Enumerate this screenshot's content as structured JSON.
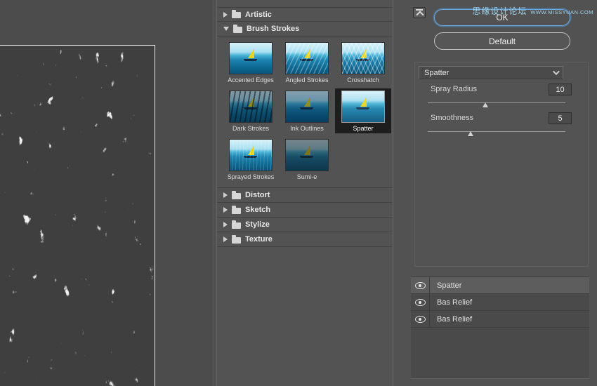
{
  "watermark": {
    "site_name": "思缘设计论坛",
    "site_url": "WWW.MISSYUAN.COM"
  },
  "colors": {
    "ok_focus_ring": "#6aa7dc",
    "watermark_text": "#9fd3ea",
    "selected_thumb_bg": "#1e1e1e"
  },
  "filter_list": {
    "categories": [
      {
        "label": "Artistic",
        "expanded": false
      },
      {
        "label": "Brush Strokes",
        "expanded": true
      },
      {
        "label": "Distort",
        "expanded": false
      },
      {
        "label": "Sketch",
        "expanded": false
      },
      {
        "label": "Stylize",
        "expanded": false
      },
      {
        "label": "Texture",
        "expanded": false
      }
    ],
    "thumbnails": [
      {
        "label": "Accented Edges",
        "selected": false
      },
      {
        "label": "Angled Strokes",
        "selected": false
      },
      {
        "label": "Crosshatch",
        "selected": false
      },
      {
        "label": "Dark Strokes",
        "selected": false
      },
      {
        "label": "Ink Outlines",
        "selected": false
      },
      {
        "label": "Spatter",
        "selected": true
      },
      {
        "label": "Sprayed Strokes",
        "selected": false
      },
      {
        "label": "Sumi-e",
        "selected": false
      }
    ]
  },
  "controls": {
    "ok_label": "OK",
    "default_label": "Default",
    "filter_select_value": "Spatter",
    "sliders": [
      {
        "label": "Spray Radius",
        "value": "10"
      },
      {
        "label": "Smoothness",
        "value": "5"
      }
    ]
  },
  "layers": {
    "rows": [
      {
        "name": "Spatter",
        "visible": true,
        "selected": true
      },
      {
        "name": "Bas Relief",
        "visible": true,
        "selected": false
      },
      {
        "name": "Bas Relief",
        "visible": true,
        "selected": false
      }
    ]
  }
}
